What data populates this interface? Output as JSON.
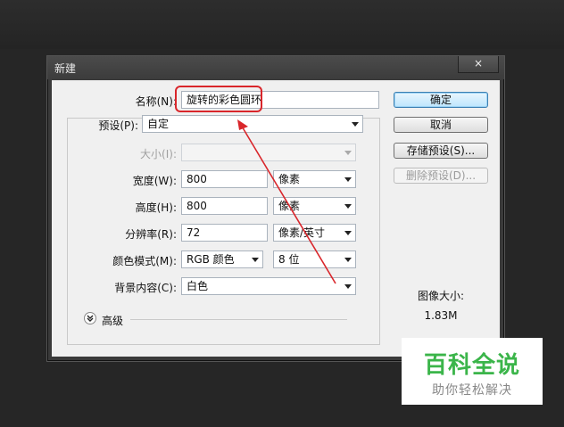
{
  "dialog": {
    "title": "新建",
    "close_label": "×"
  },
  "form": {
    "name_label": "名称(N):",
    "name_value": "旋转的彩色圆环",
    "preset_label": "预设(P):",
    "preset_value": "自定",
    "size_label": "大小(I):",
    "size_value": "",
    "width_label": "宽度(W):",
    "width_value": "800",
    "width_unit": "像素",
    "height_label": "高度(H):",
    "height_value": "800",
    "height_unit": "像素",
    "resolution_label": "分辨率(R):",
    "resolution_value": "72",
    "resolution_unit": "像素/英寸",
    "color_mode_label": "颜色模式(M):",
    "color_mode_value": "RGB 颜色",
    "bit_depth_value": "8 位",
    "background_label": "背景内容(C):",
    "background_value": "白色",
    "advanced_label": "高级"
  },
  "buttons": {
    "ok": "确定",
    "cancel": "取消",
    "save_preset": "存储预设(S)...",
    "delete_preset": "删除预设(D)..."
  },
  "image_size": {
    "label": "图像大小:",
    "value": "1.83M"
  },
  "watermark": {
    "title": "百科全说",
    "subtitle": "助你轻松解决"
  },
  "colors": {
    "highlight": "#d9262b",
    "watermark_green": "#3bb54a"
  }
}
